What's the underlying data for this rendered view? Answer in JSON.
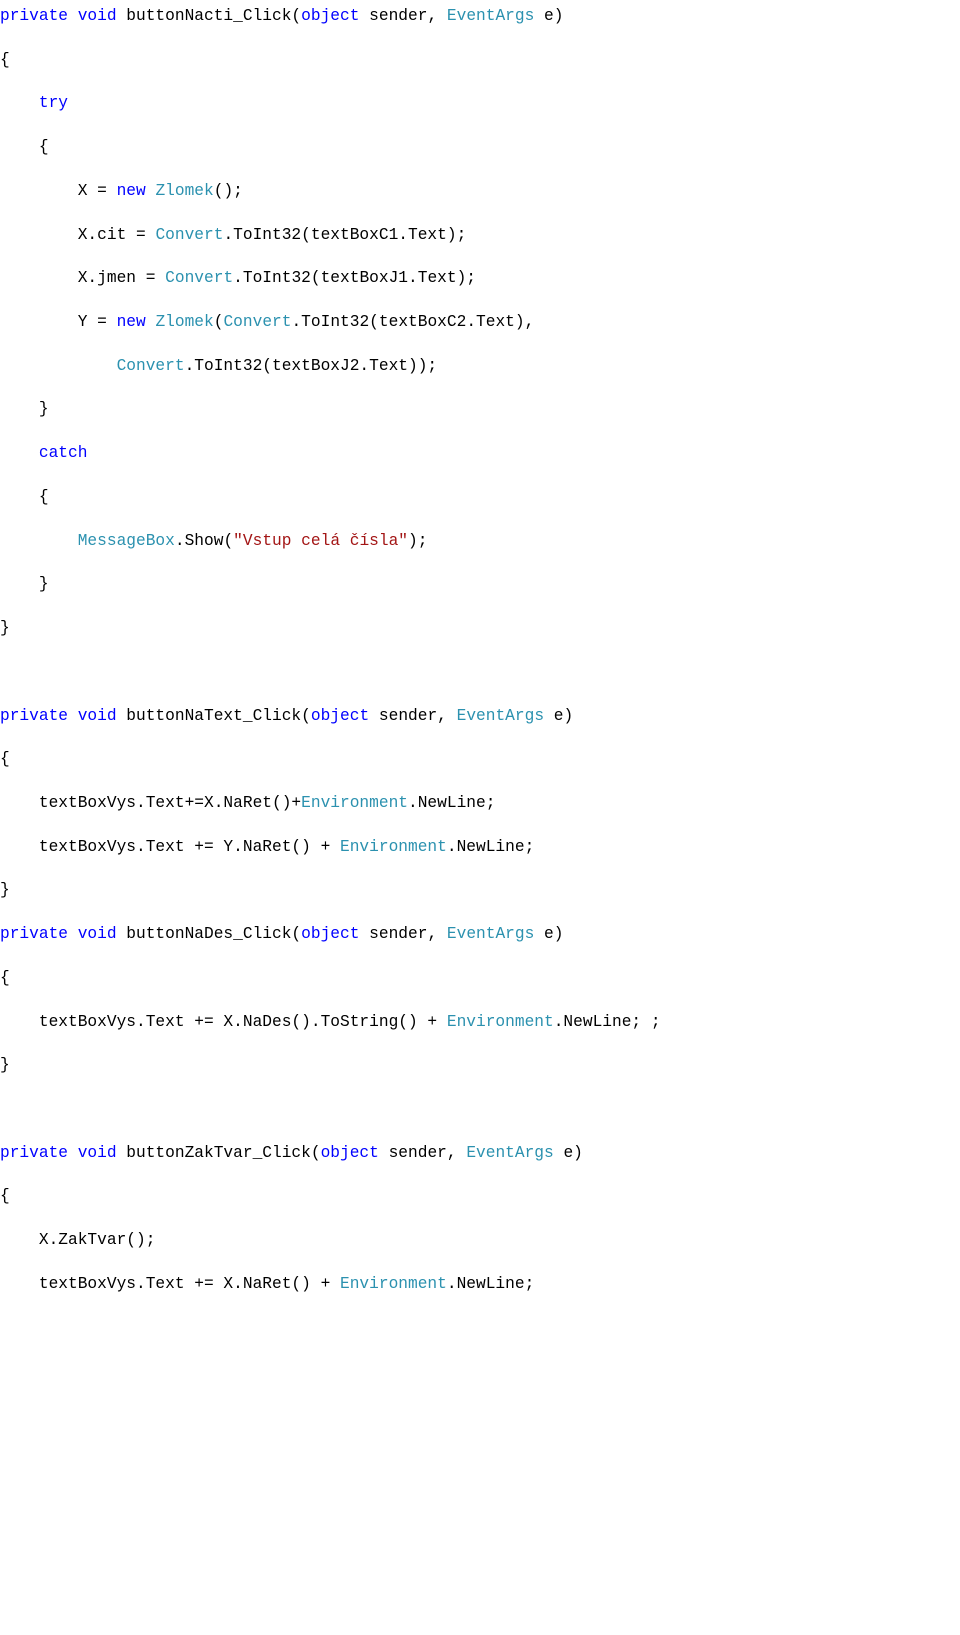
{
  "code": {
    "method1": {
      "sig_private": "private",
      "sig_void": "void",
      "sig_name": " buttonNacti_Click(",
      "sig_object": "object",
      "sig_sender": " sender, ",
      "sig_eventargs": "EventArgs",
      "sig_e": " e)",
      "open": "{",
      "try_kw": "try",
      "try_open": "{",
      "l1_a": "X = ",
      "l1_new": "new",
      "l1_sp": " ",
      "l1_zlomek": "Zlomek",
      "l1_b": "();",
      "l2_a": "X.cit = ",
      "l2_conv": "Convert",
      "l2_b": ".ToInt32(textBoxC1.Text);",
      "l3_a": "X.jmen = ",
      "l3_conv": "Convert",
      "l3_b": ".ToInt32(textBoxJ1.Text);",
      "l4_a": "Y = ",
      "l4_new": "new",
      "l4_sp": " ",
      "l4_zlomek": "Zlomek",
      "l4_b": "(",
      "l4_conv": "Convert",
      "l4_c": ".ToInt32(textBoxC2.Text),",
      "l5_conv": "Convert",
      "l5_b": ".ToInt32(textBoxJ2.Text));",
      "try_close": "}",
      "catch_kw": "catch",
      "catch_open": "{",
      "l6_mb": "MessageBox",
      "l6_a": ".Show(",
      "l6_str": "\"Vstup celá čísla\"",
      "l6_b": ");",
      "catch_close": "}",
      "close": "}"
    },
    "method2": {
      "sig_private": "private",
      "sig_void": "void",
      "sig_name": " buttonNaText_Click(",
      "sig_object": "object",
      "sig_sender": " sender, ",
      "sig_eventargs": "EventArgs",
      "sig_e": " e)",
      "open": "{",
      "l1_a": "textBoxVys.Text+=X.NaRet()+",
      "l1_env": "Environment",
      "l1_b": ".NewLine;",
      "l2_a": "textBoxVys.Text += Y.NaRet() + ",
      "l2_env": "Environment",
      "l2_b": ".NewLine;",
      "close": "}"
    },
    "method3": {
      "sig_private": "private",
      "sig_void": "void",
      "sig_name": " buttonNaDes_Click(",
      "sig_object": "object",
      "sig_sender": " sender, ",
      "sig_eventargs": "EventArgs",
      "sig_e": " e)",
      "open": "{",
      "l1_a": "textBoxVys.Text += X.NaDes().ToString() + ",
      "l1_env": "Environment",
      "l1_b": ".NewLine; ;",
      "close": "}"
    },
    "method4": {
      "sig_private": "private",
      "sig_void": "void",
      "sig_name": " buttonZakTvar_Click(",
      "sig_object": "object",
      "sig_sender": " sender, ",
      "sig_eventargs": "EventArgs",
      "sig_e": " e)",
      "open": "{",
      "l1": "X.ZakTvar();",
      "l2_a": "textBoxVys.Text += X.NaRet() + ",
      "l2_env": "Environment",
      "l2_b": ".NewLine;"
    }
  }
}
